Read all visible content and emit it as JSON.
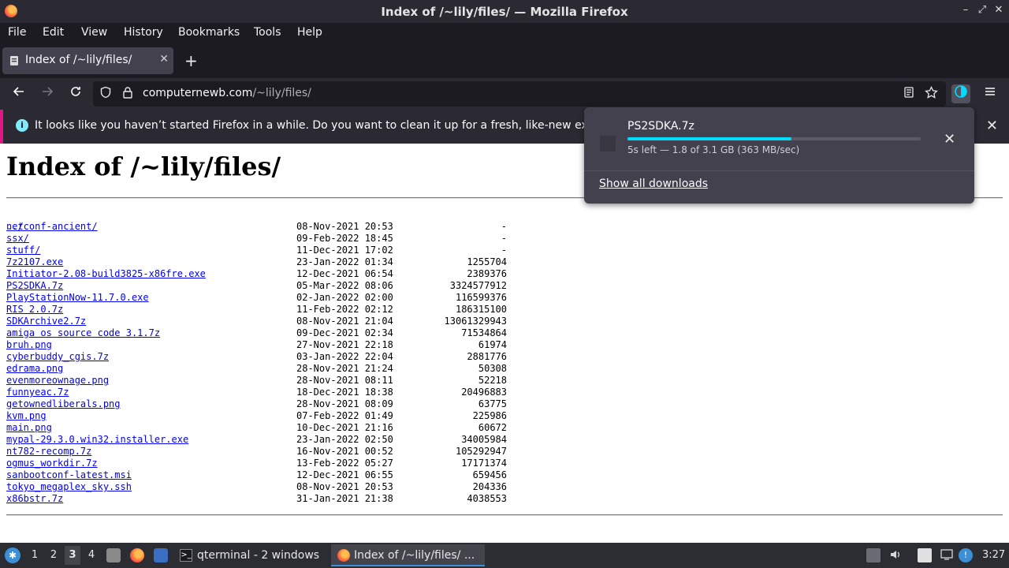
{
  "window": {
    "title": "Index of /~lily/files/ — Mozilla Firefox",
    "controls": [
      "–",
      "⤢",
      "✕"
    ]
  },
  "menu": [
    "File",
    "Edit",
    "View",
    "History",
    "Bookmarks",
    "Tools",
    "Help"
  ],
  "tab": {
    "label": "Index of /~lily/files/",
    "close": "✕",
    "new_tab": "+"
  },
  "nav": {
    "url_domain": "computernewb.com",
    "url_path": "/~lily/files/"
  },
  "notification": {
    "icon": "i",
    "text": "It looks like you haven’t started Firefox in a while. Do you want to clean it up for a fresh, like-new experie",
    "close": "✕"
  },
  "page": {
    "heading": "Index of /~lily/files/",
    "parent": "../",
    "files": [
      {
        "name": "netconf-ancient/",
        "date": "08-Nov-2021 20:53",
        "size": "-"
      },
      {
        "name": "ssx/",
        "date": "09-Feb-2022 18:45",
        "size": "-"
      },
      {
        "name": "stuff/",
        "date": "11-Dec-2021 17:02",
        "size": "-"
      },
      {
        "name": "7z2107.exe",
        "date": "23-Jan-2022 01:34",
        "size": "1255704"
      },
      {
        "name": "Initiator-2.08-build3825-x86fre.exe",
        "date": "12-Dec-2021 06:54",
        "size": "2389376"
      },
      {
        "name": "PS2SDKA.7z",
        "date": "05-Mar-2022 08:06",
        "size": "3324577912"
      },
      {
        "name": "PlayStationNow-11.7.0.exe",
        "date": "02-Jan-2022 02:00",
        "size": "116599376"
      },
      {
        "name": "RIS 2.0.7z",
        "date": "11-Feb-2022 02:12",
        "size": "186315100"
      },
      {
        "name": "SDKArchive2.7z",
        "date": "08-Nov-2021 21:04",
        "size": "13061329943"
      },
      {
        "name": "amiga os source code 3.1.7z",
        "date": "09-Dec-2021 02:34",
        "size": "71534864"
      },
      {
        "name": "bruh.png",
        "date": "27-Nov-2021 22:18",
        "size": "61974"
      },
      {
        "name": "cyberbuddy_cgis.7z",
        "date": "03-Jan-2022 22:04",
        "size": "2881776"
      },
      {
        "name": "edrama.png",
        "date": "28-Nov-2021 21:24",
        "size": "50308"
      },
      {
        "name": "evenmoreownage.png",
        "date": "28-Nov-2021 08:11",
        "size": "52218"
      },
      {
        "name": "funnyeac.7z",
        "date": "18-Dec-2021 18:38",
        "size": "20496883"
      },
      {
        "name": "getownedliberals.png",
        "date": "28-Nov-2021 08:09",
        "size": "63775"
      },
      {
        "name": "kvm.png",
        "date": "07-Feb-2022 01:49",
        "size": "225986"
      },
      {
        "name": "main.png",
        "date": "10-Dec-2021 21:16",
        "size": "60672"
      },
      {
        "name": "mypal-29.3.0.win32.installer.exe",
        "date": "23-Jan-2022 02:50",
        "size": "34005984"
      },
      {
        "name": "nt782-recomp.7z",
        "date": "16-Nov-2021 00:52",
        "size": "105292947"
      },
      {
        "name": "ogmus_workdir.7z",
        "date": "13-Feb-2022 05:27",
        "size": "17171374"
      },
      {
        "name": "sanbootconf-latest.msi",
        "date": "12-Dec-2021 06:55",
        "size": "659456"
      },
      {
        "name": "tokyo_megaplex_sky.ssh",
        "date": "08-Nov-2021 20:53",
        "size": "204336"
      },
      {
        "name": "x86bstr.7z",
        "date": "31-Jan-2021 21:38",
        "size": "4038553"
      }
    ]
  },
  "downloads": {
    "filename": "PS2SDKA.7z",
    "progress": 0.56,
    "status": "5s left — 1.8 of 3.1 GB (363 MB/sec)",
    "show_all": "Show all downloads",
    "close": "✕"
  },
  "taskbar": {
    "workspaces": [
      "1",
      "2",
      "3",
      "4"
    ],
    "active_workspace": "3",
    "tasks": [
      {
        "label": "qterminal - 2 windows"
      },
      {
        "label": "Index of /~lily/files/ ..."
      }
    ],
    "clock": "3:27"
  }
}
